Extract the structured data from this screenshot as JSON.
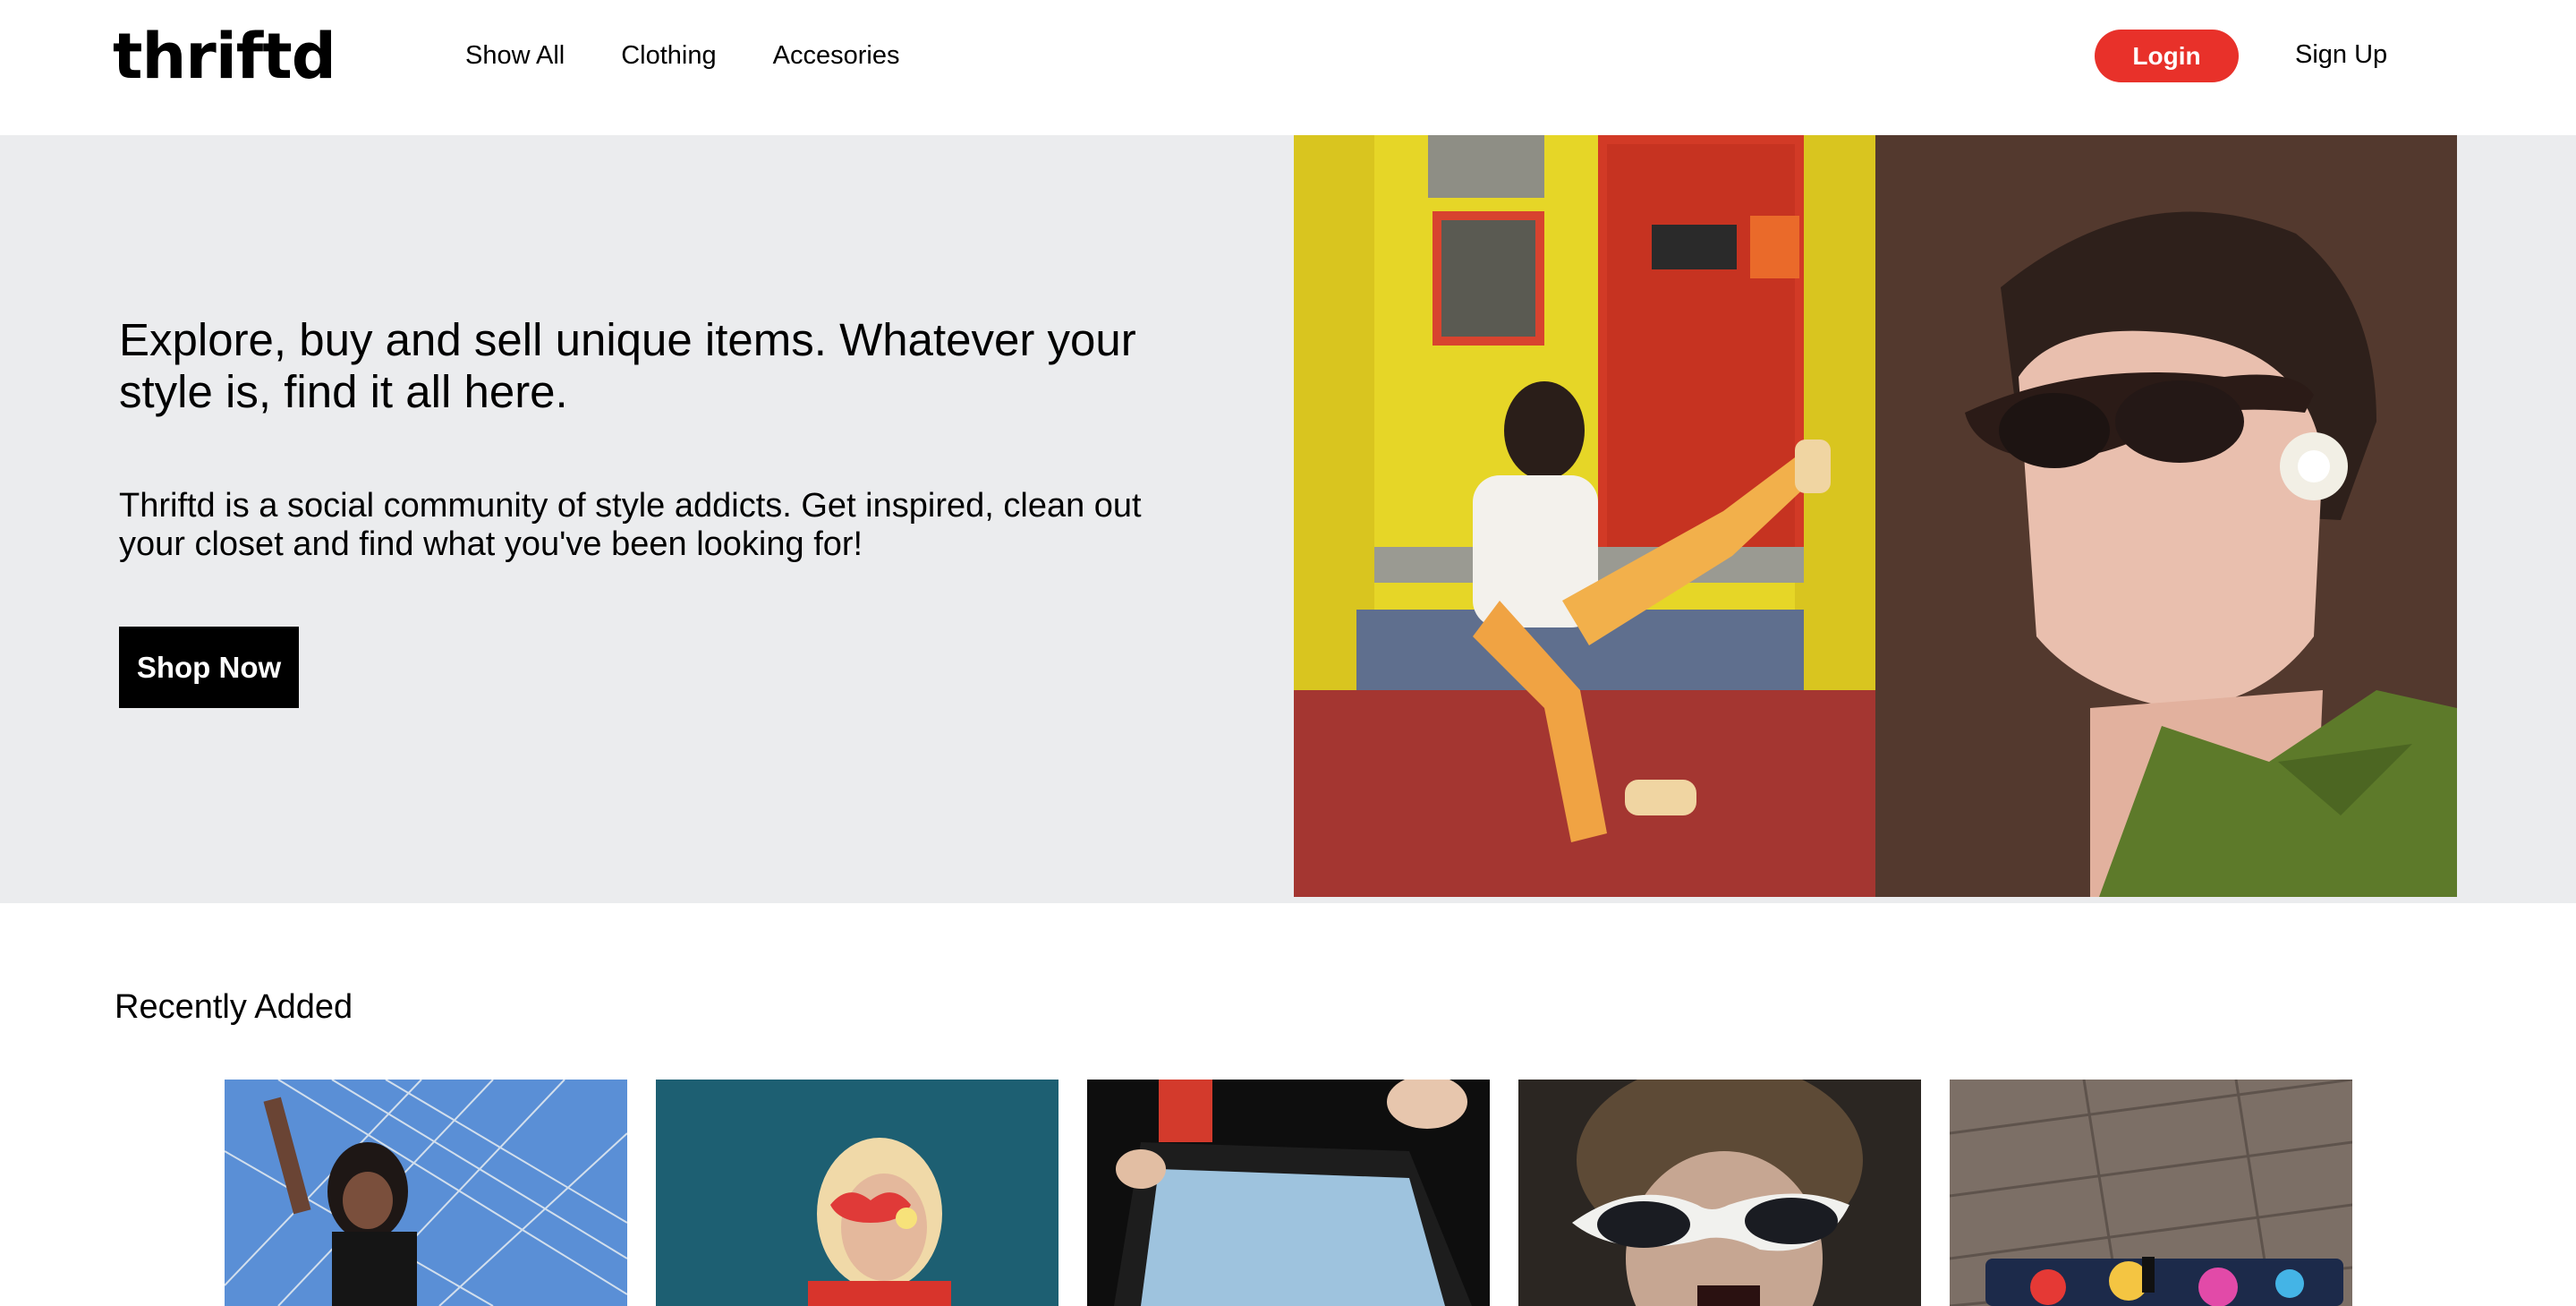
{
  "brand": {
    "logo_text": "thriftd"
  },
  "nav": {
    "links": [
      "Show All",
      "Clothing",
      "Accesories"
    ],
    "login_label": "Login",
    "signup_label": "Sign Up"
  },
  "hero": {
    "title": "Explore, buy and sell unique items. Whatever your style is, find it all here.",
    "subtitle": "Thriftd is a social community of style addicts. Get inspired, clean out your closet and find what you've been looking for!",
    "cta_label": "Shop Now"
  },
  "recent": {
    "title": "Recently Added",
    "items": [
      {
        "image": "woman-on-fence-photo"
      },
      {
        "image": "woman-heart-sunglasses-photo"
      },
      {
        "image": "tv-static-photo"
      },
      {
        "image": "woman-cateye-sunglasses-photo"
      },
      {
        "image": "patterned-wallet-photo"
      }
    ]
  },
  "colors": {
    "accent": "#e8312a",
    "hero_bg": "#ebecee",
    "cta_bg": "#000000"
  }
}
